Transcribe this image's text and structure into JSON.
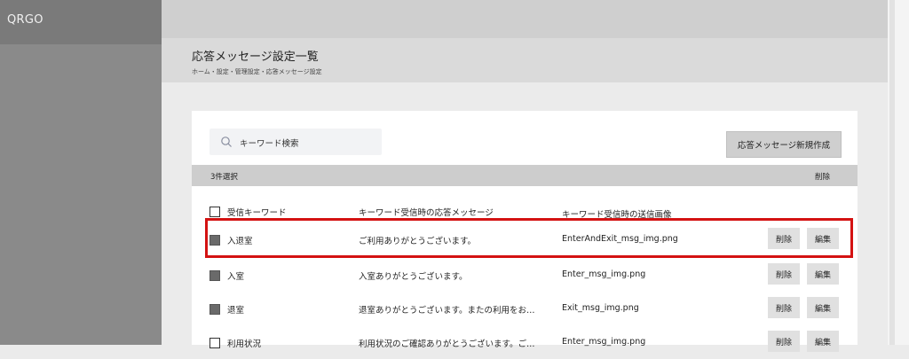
{
  "app": {
    "brand": "QRGO"
  },
  "page": {
    "title": "応答メッセージ設定一覧",
    "breadcrumb": "ホーム・設定・管理設定・応答メッセージ設定"
  },
  "search": {
    "placeholder": "キーワード検索",
    "icon": "search-icon"
  },
  "toolbar": {
    "new_button": "応答メッセージ新規作成"
  },
  "selection": {
    "count_label": "3件選択",
    "bulk_delete": "削除"
  },
  "table": {
    "headers": [
      "受信キーワード",
      "キーワード受信時の応答メッセージ",
      "キーワード受信時の送信画像"
    ],
    "rows": [
      {
        "checked": true,
        "keyword": "入退室",
        "message": "ご利用ありがとうございます。",
        "image": "EnterAndExit_msg_img.png",
        "delete": "削除",
        "edit": "編集"
      },
      {
        "checked": true,
        "keyword": "入室",
        "message": "入室ありがとうございます。",
        "image": "Enter_msg_img.png",
        "delete": "削除",
        "edit": "編集"
      },
      {
        "checked": true,
        "keyword": "退室",
        "message": "退室ありがとうございます。またの利用をお…",
        "image": "Exit_msg_img.png",
        "delete": "削除",
        "edit": "編集"
      },
      {
        "checked": false,
        "keyword": "利用状況",
        "message": "利用状況のご確認ありがとうございます。ご…",
        "image": "Enter_msg_img.png",
        "delete": "削除",
        "edit": "編集"
      }
    ]
  },
  "colors": {
    "highlight": "#d41212",
    "sidebar": "#8a8a8a",
    "checkbox_filled": "#6a6a6a"
  }
}
